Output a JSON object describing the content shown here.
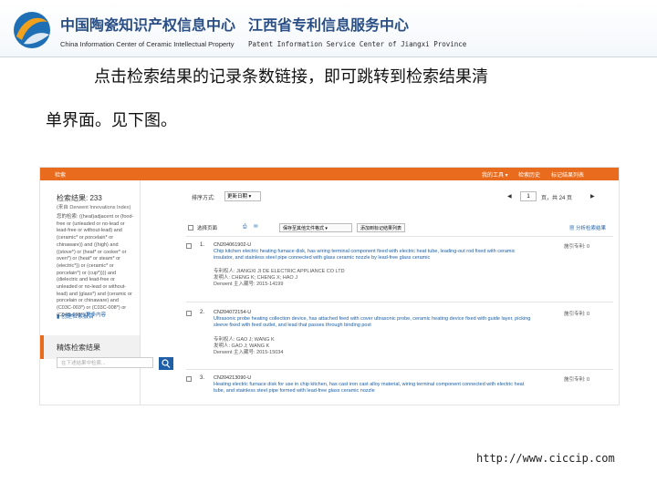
{
  "header": {
    "org1_cn": "中国陶瓷知识产权信息中心",
    "org1_en": "China Information Center of Ceramic Intellectual Property",
    "org2_cn": "江西省专利信息服务中心",
    "org2_en": "Patent Information Service Center of Jiangxi Province"
  },
  "desc": {
    "line1": "点击检索结果的记录条数链接，即可跳转到检索结果清",
    "line2": "单界面。见下图。"
  },
  "screenshot": {
    "appbar": {
      "brand": "检索",
      "nav": [
        "我的工具 ▾",
        "检索历史",
        "标记结果列表"
      ]
    },
    "left": {
      "result_count": "检索结果: 233",
      "index_note": "(来自 Derwent Innovations Index)",
      "query": "您的检索: ((heat)adjacent or (food-free or (unleaded or no-lead or lead-free or without-lead) and (ceramic* or porcelain* or chinaware)) and ((high) and ((stove*) or (heat* or cooker* or oven*) or (heat* or steam* or (electric*)) or (ceramic* or porcelain*) or (cup*)))) and (dielectric and lead-free or unleaded or no-lead or without-lead) and (glass*) and (ceramic or porcelain or chinaware) and (C03C-003*) or (C03C-008*) or (C04B-035*)",
      "more": "更多内容",
      "analyze": "创建检索报告",
      "refine_title": "精炼检索结果",
      "refine_placeholder": "在下述结果中检索..."
    },
    "sort_label": "排序方式:",
    "sort_value": "更新日期",
    "pager": {
      "page": "1",
      "of": "页，共 24 页"
    },
    "toolbar": {
      "select_page": "选择页面",
      "export": "保存至其他文件格式",
      "add_to_marked": "添加到标记结果列表",
      "analyze": "分析检索结果"
    },
    "records": [
      {
        "num": "1.",
        "id": "CN204061902-U",
        "title": "Chip kitchen electric heating furnace disk, has wiring terminal component fixed with electric heat tube, leading-out rod fixed with ceramic insulator, and stainless steel pipe connected with glass ceramic nozzle by lead-free glass ceramic",
        "meta1": "专利权人: JIANGXI JI DE ELECTRIC APPLIANCE CO LTD",
        "meta2": "发明人: CHENG K; CHENG X; HAO J",
        "meta3": "Derwent 主入藏号: 2015-14199",
        "cite": "施引专利: 0"
      },
      {
        "num": "2.",
        "id": "CN204072154-U",
        "title": "Ultrasonic probe heating collection device, has attached feed with cover ultrasonic probe, ceramic heating device fixed with guide layer, picking sleeve fixed with feed outlet, and lead that passes through binding post",
        "meta1": "专利权人: GAO J; WANG K",
        "meta2": "发明人: GAO J; WANG K",
        "meta3": "Derwent 主入藏号: 2015-15034",
        "cite": "施引专利: 0"
      },
      {
        "num": "3.",
        "id": "CN204213090-U",
        "title": "Heating electric furnace disk for use in chip kitchen, has cast iron cast alloy material, wiring terminal component connected with electric heat tube, and stainless steel pipe formed with lead-free glass ceramic nozzle",
        "cite": "施引专利: 0"
      }
    ]
  },
  "footer_url": "http://www.ciccip.com"
}
